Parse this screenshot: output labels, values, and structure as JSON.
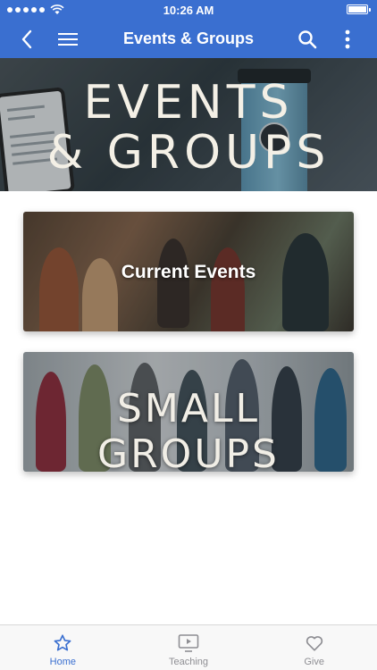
{
  "status_bar": {
    "time": "10:26 AM",
    "signal_icon": "signal-dots-icon",
    "wifi_icon": "wifi-icon",
    "battery_icon": "battery-icon"
  },
  "nav": {
    "title": "Events & Groups",
    "back_icon": "chevron-left-icon",
    "menu_icon": "hamburger-menu-icon",
    "search_icon": "search-icon",
    "more_icon": "more-vertical-icon"
  },
  "hero": {
    "title_line1": "EVENTS",
    "title_line2": "& GROUPS"
  },
  "cards": {
    "events_title": "Current Events",
    "groups_title": "SMALL GROUPS"
  },
  "tabs": [
    {
      "label": "Home",
      "icon": "star-icon",
      "active": true
    },
    {
      "label": "Teaching",
      "icon": "video-play-icon",
      "active": false
    },
    {
      "label": "Give",
      "icon": "heart-icon",
      "active": false
    }
  ],
  "colors": {
    "accent": "#3a6fd0",
    "tab_inactive": "#8e8e93"
  }
}
